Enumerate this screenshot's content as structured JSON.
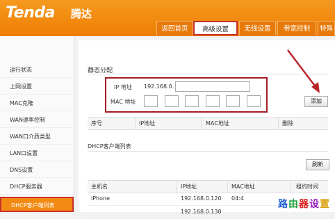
{
  "brand": {
    "logo": "Tenda",
    "name_cn": "腾达"
  },
  "tabs": [
    {
      "label": "返回首页",
      "active": false
    },
    {
      "label": "高级设置",
      "active": true
    },
    {
      "label": "无线设置",
      "active": false
    },
    {
      "label": "带宽控制",
      "active": false
    },
    {
      "label": "特殊",
      "active": false
    }
  ],
  "sidebar": {
    "items": [
      {
        "label": "运行状态",
        "active": false
      },
      {
        "label": "上网设置",
        "active": false
      },
      {
        "label": "MAC克隆",
        "active": false
      },
      {
        "label": "WAN速率控制",
        "active": false
      },
      {
        "label": "WAN口介质类型",
        "active": false
      },
      {
        "label": "LAN口设置",
        "active": false
      },
      {
        "label": "DNS设置",
        "active": false
      },
      {
        "label": "DHCP服务器",
        "active": false
      },
      {
        "label": "DHCP客户端列表",
        "active": true
      }
    ]
  },
  "static_alloc": {
    "title": "静态分配",
    "ip_label": "IP 地址",
    "ip_prefix": "192.168.0.",
    "ip_value": "",
    "mac_label": "MAC 地址",
    "add_button": "添加",
    "table_headers": [
      "序号",
      "IP地址",
      "MAC地址",
      "删除"
    ]
  },
  "client_list": {
    "title": "DHCP客户端列表",
    "refresh_button": "刷新",
    "headers": [
      "主机名",
      "IP地址",
      "MAC地址",
      "租约时间"
    ],
    "rows": [
      {
        "host": "iPhone",
        "ip": "192.168.0.120",
        "mac": "04:4",
        "lease": ""
      },
      {
        "host": "",
        "ip": "192.168.0.130",
        "mac": "",
        "lease": ""
      }
    ]
  },
  "watermark": {
    "text": "路由器设置",
    "colors": [
      "#1f5fd8",
      "#1ca23c",
      "#d8201f",
      "#a020c8",
      "#d8a010"
    ]
  },
  "colors": {
    "accent": "#f28a14",
    "highlight_box": "#a61c24"
  }
}
